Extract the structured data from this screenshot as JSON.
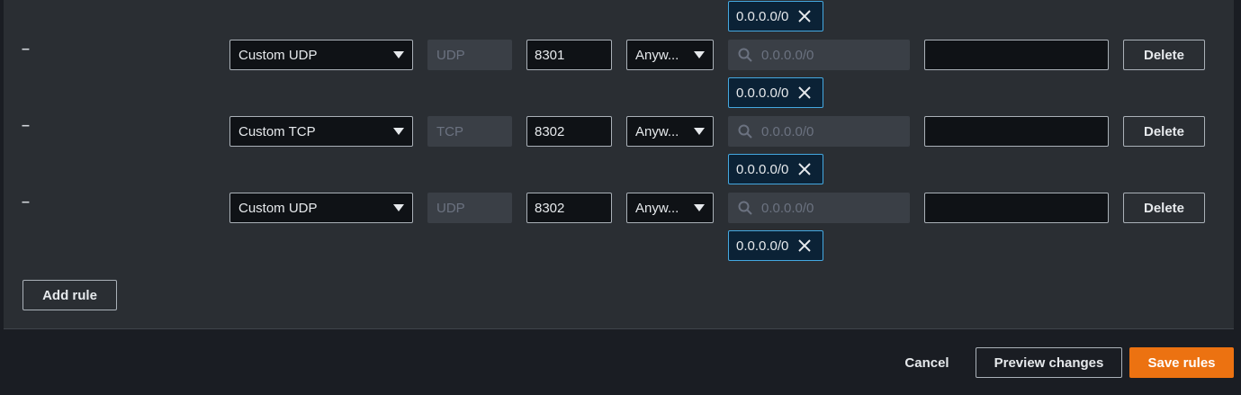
{
  "rows": [
    {
      "remove": "–",
      "type": "Custom UDP",
      "protocol": "UDP",
      "port": "8301",
      "source": "Anyw...",
      "search_placeholder": "0.0.0.0/0",
      "description": "",
      "delete_label": "Delete",
      "token": "0.0.0.0/0"
    },
    {
      "remove": "–",
      "type": "Custom TCP",
      "protocol": "TCP",
      "port": "8302",
      "source": "Anyw...",
      "search_placeholder": "0.0.0.0/0",
      "description": "",
      "delete_label": "Delete",
      "token": "0.0.0.0/0"
    },
    {
      "remove": "–",
      "type": "Custom UDP",
      "protocol": "UDP",
      "port": "8302",
      "source": "Anyw...",
      "search_placeholder": "0.0.0.0/0",
      "description": "",
      "delete_label": "Delete",
      "token": "0.0.0.0/0"
    }
  ],
  "top_token": "0.0.0.0/0",
  "add_rule_label": "Add rule",
  "footer": {
    "cancel": "Cancel",
    "preview": "Preview changes",
    "save": "Save rules"
  },
  "colors": {
    "accent": "#ec7211",
    "token_border": "#44a8e0"
  }
}
